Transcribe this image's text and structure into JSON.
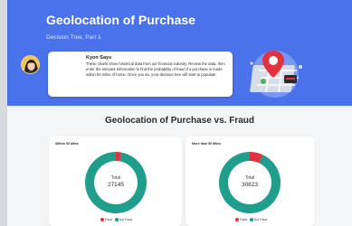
{
  "hero": {
    "title": "Geolocation of Purchase",
    "subtitle": "Decision Tree, Part 1"
  },
  "message": {
    "name": "Kyon Says",
    "text": "These charts show historical data from our financial industry. Review the data, then enter the relevant information to find the probability of fraud if a purchase is made within 50 miles of home. Once you do, your decision tree will start to populate."
  },
  "section": {
    "title": "Geolocation of Purchase vs. Fraud"
  },
  "colors": {
    "hero_bg": "#4a72ea",
    "fraud": "#e0333f",
    "not_fraud": "#1f9e8d"
  },
  "chart_data": [
    {
      "type": "pie",
      "title": "Within 50 Miles",
      "center_label": "Total",
      "total": "27145",
      "categories": [
        "Fraud",
        "Not Fraud"
      ],
      "values": [
        3,
        97
      ]
    },
    {
      "type": "pie",
      "title": "More than 50 Miles",
      "center_label": "Total",
      "total": "30823",
      "categories": [
        "Fraud",
        "Not Fraud"
      ],
      "values": [
        7,
        93
      ]
    }
  ]
}
